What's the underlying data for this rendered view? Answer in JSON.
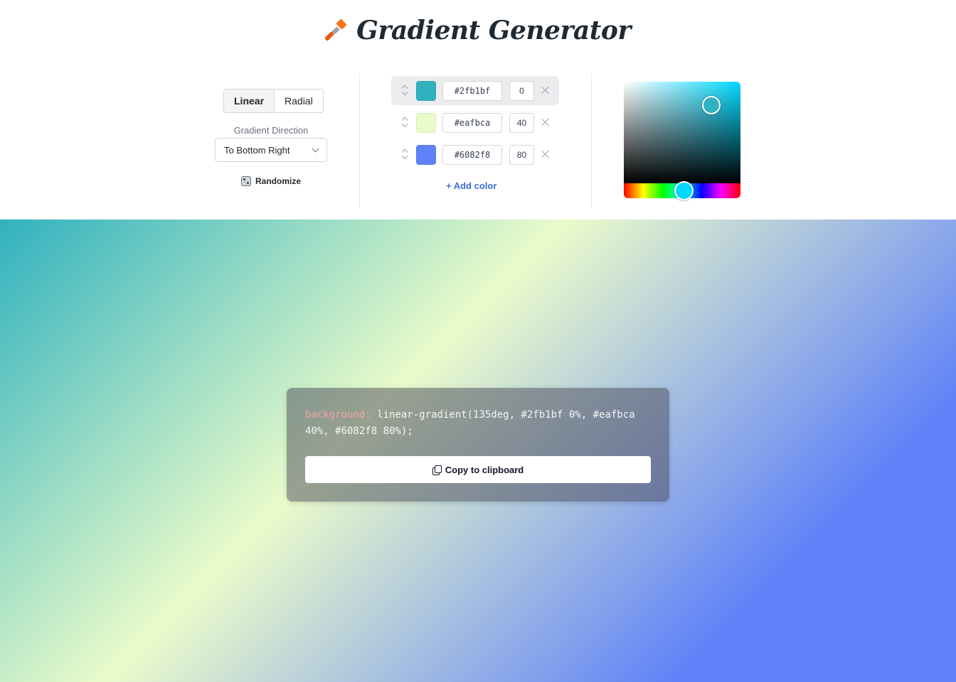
{
  "header": {
    "title": "Gradient Generator",
    "icon": "paintbrush-icon"
  },
  "controls": {
    "type_options": [
      "Linear",
      "Radial"
    ],
    "selected_type": "Linear",
    "direction_label": "Gradient Direction",
    "direction_value": "To Bottom Right",
    "randomize_label": "Randomize"
  },
  "stops": [
    {
      "color": "#2fb1bf",
      "hex": "#2fb1bf",
      "position": "0",
      "active": true
    },
    {
      "color": "#eafbca",
      "hex": "#eafbca",
      "position": "40",
      "active": false
    },
    {
      "color": "#6082f8",
      "hex": "#6082f8",
      "position": "80",
      "active": false
    }
  ],
  "add_color_label": "+ Add color",
  "picker": {
    "hue_color": "#00d9ff",
    "selected_color": "#2fb1bf"
  },
  "output": {
    "property": "background:",
    "value": "linear-gradient(135deg, #2fb1bf 0%, #eafbca 40%, #6082f8 80%);",
    "copy_label": "Copy to clipboard"
  }
}
